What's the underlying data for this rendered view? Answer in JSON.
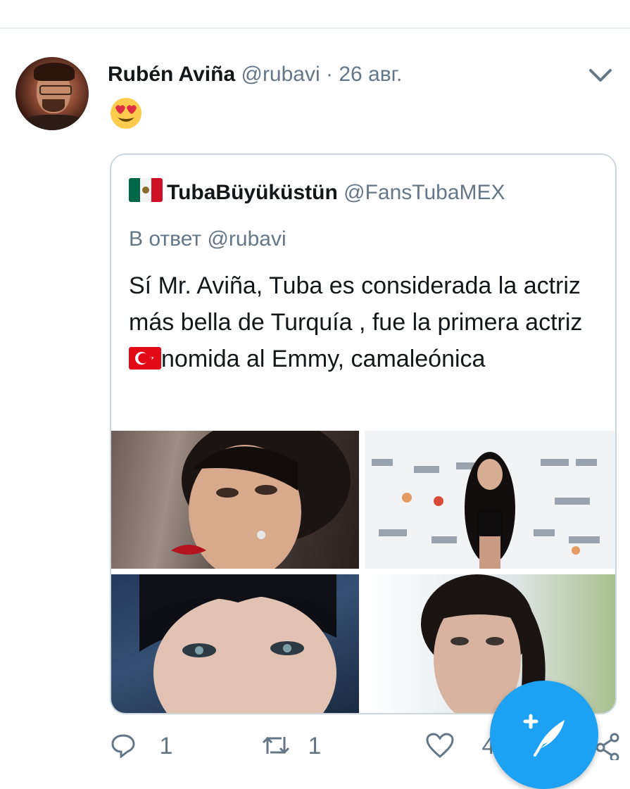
{
  "tweet": {
    "author_name": "Rubén Aviña",
    "author_handle": "@rubavi",
    "separator": "·",
    "date": "26 авг.",
    "body_emoji": "heart-eyes-emoji"
  },
  "quote": {
    "flag_icon": "mexico-flag-icon",
    "name": "TubaBüyüküstün",
    "handle": "@FansTubaMEX",
    "reply_to": "В ответ @rubavi",
    "text_before_flag": "Sí Mr. Aviña, Tuba es considerada la actriz más bella de Turquía , fue la primera actriz",
    "inline_flag_icon": "turkey-flag-icon",
    "text_after_flag": "nomida al Emmy, camaleónica",
    "photos": [
      "portrait-red-lips",
      "red-carpet-emmy",
      "portrait-short-hair",
      "portrait-bangs"
    ]
  },
  "actions": {
    "reply_count": "1",
    "retweet_count": "1",
    "like_count": "4"
  },
  "colors": {
    "primary_text": "#14171a",
    "secondary_text": "#657786",
    "accent": "#1da1f2",
    "border": "#ccd6dd"
  }
}
